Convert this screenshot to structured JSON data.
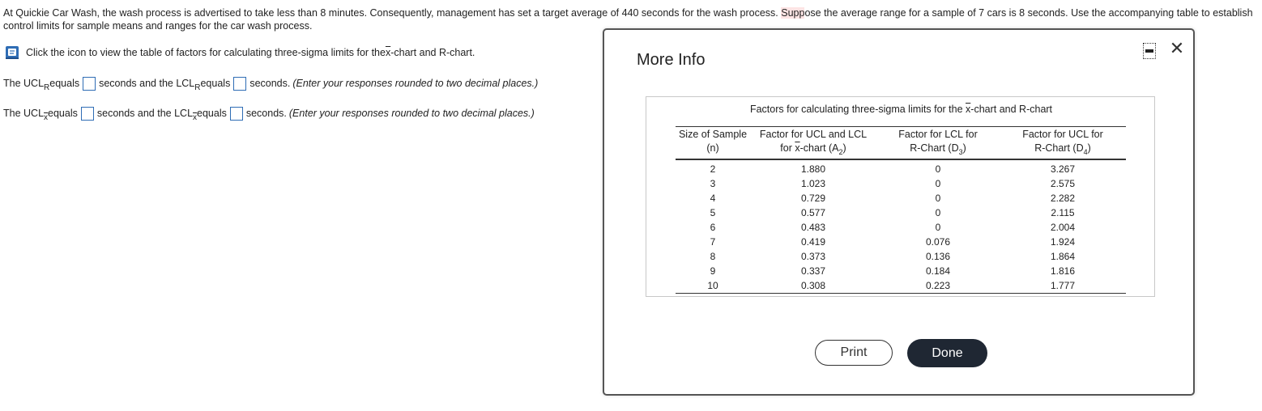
{
  "problem": {
    "text_before": "At Quickie Car Wash, the wash process is advertised to take less than 8 minutes. Consequently, management has set a target average of 440 seconds for the wash process. ",
    "text_highlight": "Supp",
    "text_after": "ose the average range for a sample of 7 cars is 8 seconds. Use the accompanying table to establish control limits for sample means and ranges for the car wash process."
  },
  "hint": {
    "text_before": "Click the icon to view the table of factors for calculating three-sigma limits for the ",
    "xbar": "x",
    "text_after": "-chart and R-chart."
  },
  "question_r": {
    "part1": "The UCL",
    "sub1": "R",
    "part2": " equals",
    "part3": "seconds and the LCL",
    "sub2": "R",
    "part4": " equals",
    "part5": "seconds.",
    "instruction": "(Enter your responses rounded to two decimal places.)"
  },
  "question_x": {
    "part1": "The UCL",
    "sub1": "x",
    "part2": " equals",
    "part3": "seconds and the LCL",
    "sub2": "x",
    "part4": " equals",
    "part5": "seconds.",
    "instruction": "(Enter your responses rounded to two decimal places.)"
  },
  "modal": {
    "title": "More Info",
    "caption_before": "Factors for calculating three-sigma limits for the ",
    "caption_xbar": "x",
    "caption_after": "-chart and R-chart",
    "headers": {
      "col1_line1": "Size of Sample",
      "col1_line2": "(n)",
      "col2_line1": "Factor for UCL and LCL",
      "col2_line2_pre": "for ",
      "col2_xbar": "x",
      "col2_line2_post": "-chart (A",
      "col2_sub": "2",
      "col2_close": ")",
      "col3_line1": "Factor for LCL for",
      "col3_line2": "R-Chart (D",
      "col3_sub": "3",
      "col3_close": ")",
      "col4_line1": "Factor for UCL for",
      "col4_line2": "R-Chart (D",
      "col4_sub": "4",
      "col4_close": ")"
    },
    "rows": [
      [
        "2",
        "1.880",
        "0",
        "3.267"
      ],
      [
        "3",
        "1.023",
        "0",
        "2.575"
      ],
      [
        "4",
        "0.729",
        "0",
        "2.282"
      ],
      [
        "5",
        "0.577",
        "0",
        "2.115"
      ],
      [
        "6",
        "0.483",
        "0",
        "2.004"
      ],
      [
        "7",
        "0.419",
        "0.076",
        "1.924"
      ],
      [
        "8",
        "0.373",
        "0.136",
        "1.864"
      ],
      [
        "9",
        "0.337",
        "0.184",
        "1.816"
      ],
      [
        "10",
        "0.308",
        "0.223",
        "1.777"
      ]
    ],
    "print_label": "Print",
    "done_label": "Done",
    "close_glyph": "✕"
  },
  "colors": {
    "accent_blue": "#2f6db5",
    "done_bg": "#1f2733",
    "highlight": "#fde4e4"
  },
  "icons": {
    "hint": "book-icon",
    "minimize": "minimize-icon",
    "close": "close-icon"
  }
}
